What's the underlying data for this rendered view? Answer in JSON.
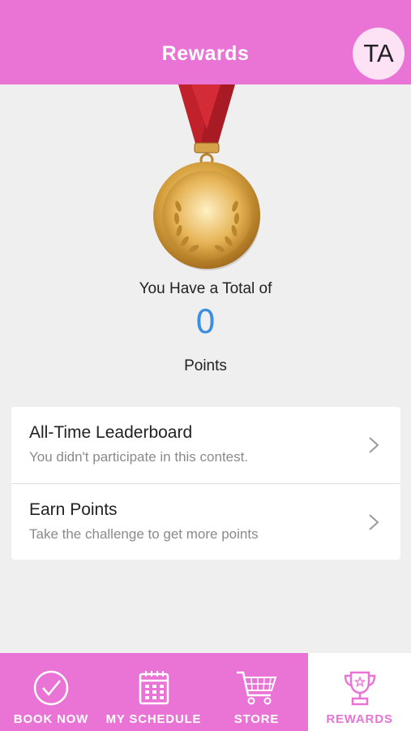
{
  "header": {
    "title": "Rewards",
    "avatar_initials": "TA"
  },
  "summary": {
    "total_text": "You Have a Total of",
    "points": "0",
    "points_label": "Points"
  },
  "list": [
    {
      "title": "All-Time Leaderboard",
      "subtitle": "You didn't participate in this contest."
    },
    {
      "title": "Earn Points",
      "subtitle": "Take the challenge to get more points"
    }
  ],
  "tabs": [
    {
      "label": "BOOK NOW",
      "icon": "check-circle-icon"
    },
    {
      "label": "MY SCHEDULE",
      "icon": "calendar-icon"
    },
    {
      "label": "STORE",
      "icon": "cart-icon"
    },
    {
      "label": "REWARDS",
      "icon": "trophy-icon",
      "active": true
    }
  ],
  "colors": {
    "brand_pink": "#ea74d6",
    "points_blue": "#3c8fe0",
    "ribbon_red": "#c0212b",
    "gold": "#d9a441"
  }
}
